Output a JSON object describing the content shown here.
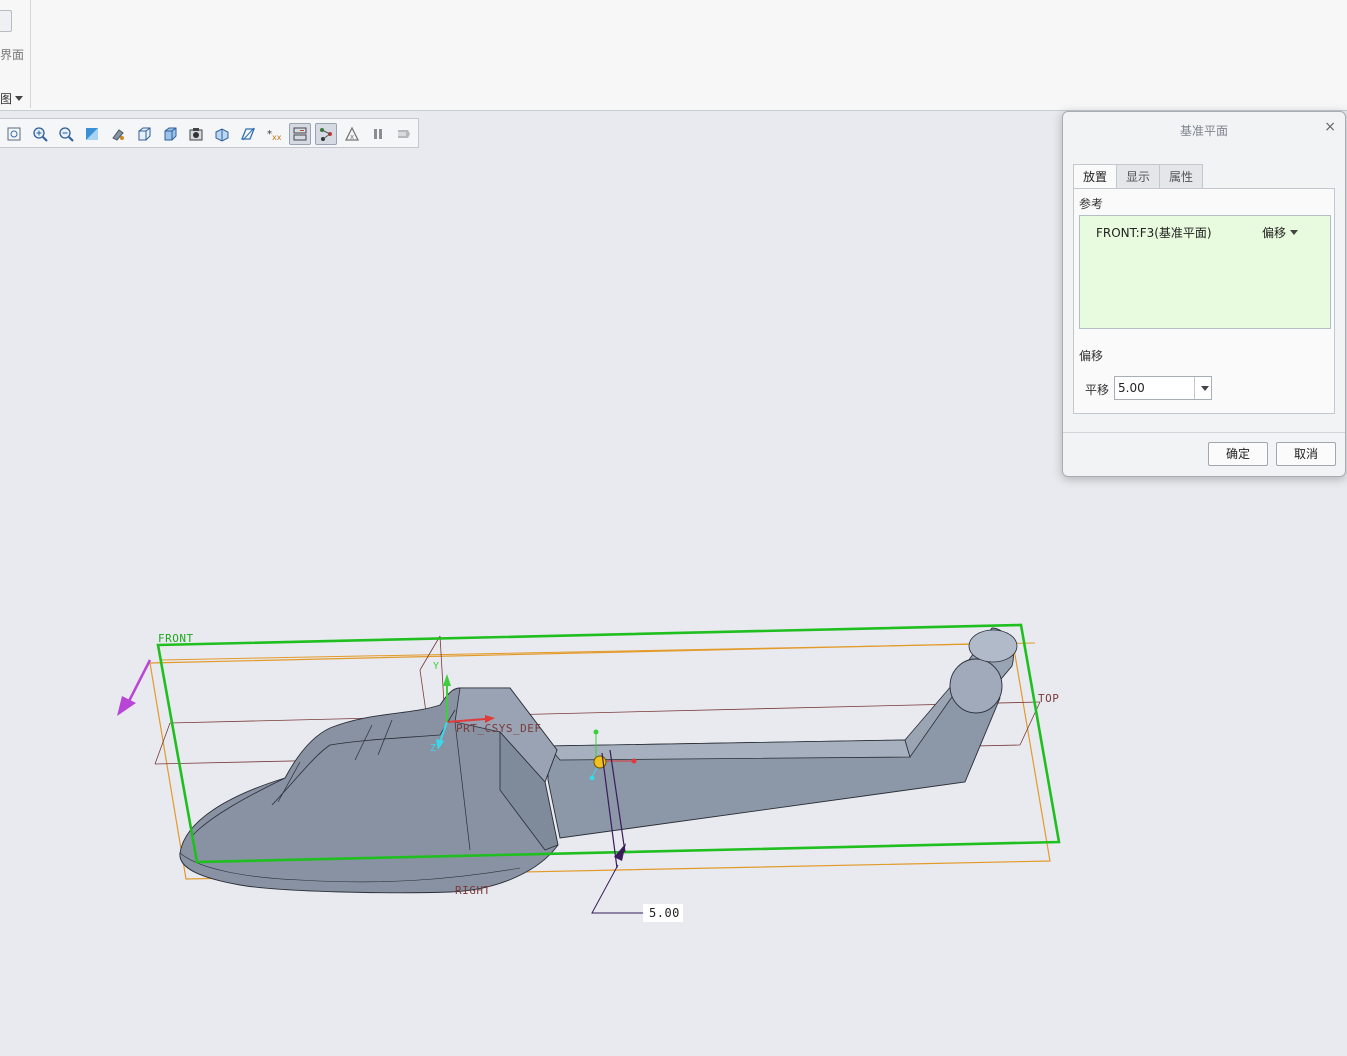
{
  "ribbon": {
    "interface_label": "界面",
    "view_label": "图"
  },
  "toolbar": {
    "buttons": [
      "refit-icon",
      "zoom-in-icon",
      "zoom-out-icon",
      "repaint-icon",
      "view-manager-icon",
      "saved-orientations-icon",
      "display-style-icon",
      "perspective-icon",
      "section-icon",
      "datum-display-icon",
      "annotation-display-icon",
      "spin-center-icon",
      "datum-plane-toggle-icon",
      "datum-point-toggle-icon",
      "datum-axis-icon",
      "pause-icon",
      "next-icon"
    ]
  },
  "viewport": {
    "labels": {
      "front": "FRONT",
      "top": "TOP",
      "right": "RIGHT",
      "csys": "PRT_CSYS_DEF",
      "y_axis": "Y",
      "z_axis": "Z",
      "offset_dim": "5.00"
    },
    "colors": {
      "preview_plane": "#1fbf1f",
      "datum_plane": "#e39a2a",
      "model_fill": "#8c97a8",
      "direction_arrow": "#b845d6"
    }
  },
  "dialog": {
    "title": "基准平面",
    "close_glyph": "×",
    "tabs": [
      "放置",
      "显示",
      "属性"
    ],
    "active_tab": "放置",
    "references_label": "参考",
    "reference_item": "FRONT:F3(基准平面)",
    "reference_constraint": "偏移",
    "offset_section_label": "偏移",
    "translation_label": "平移",
    "translation_value": "5.00",
    "ok_label": "确定",
    "cancel_label": "取消"
  }
}
